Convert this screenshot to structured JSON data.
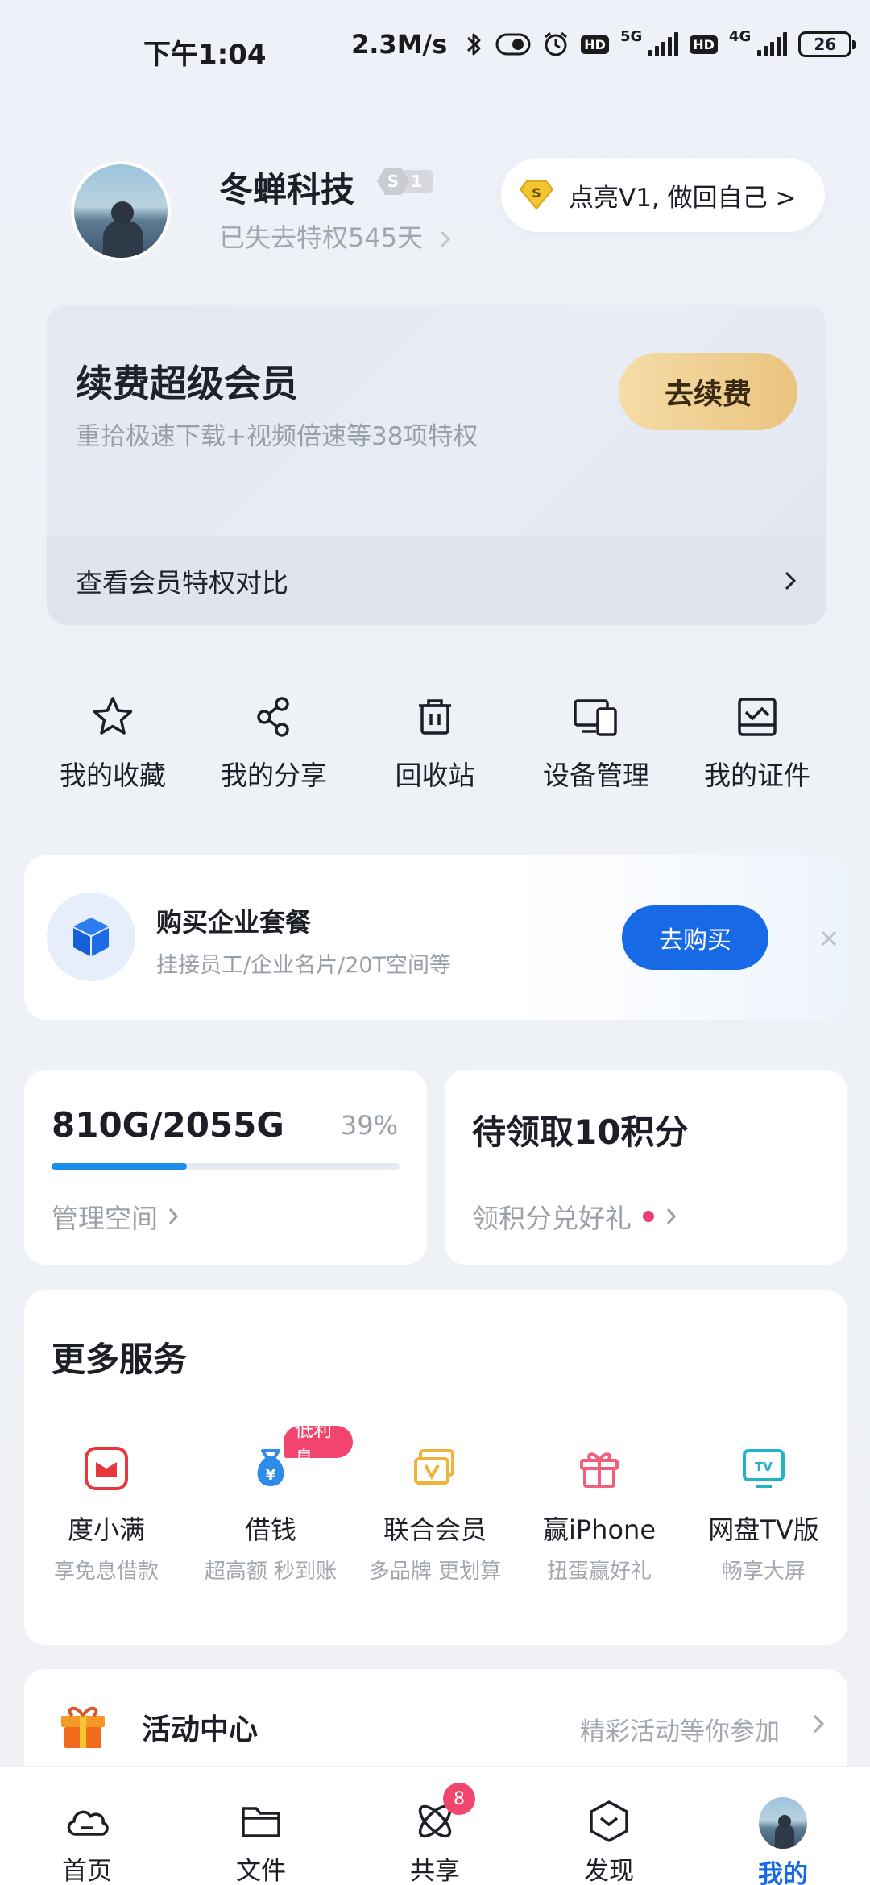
{
  "status_bar": {
    "time": "下午1:04",
    "speed": "2.3M/s",
    "hd_1": "HD",
    "net_1": "5G",
    "hd_2": "HD",
    "net_2": "4G",
    "battery": "26"
  },
  "profile": {
    "name": "冬蝉科技",
    "level_letter": "S",
    "level_number": "1",
    "expiry": "已失去特权545天",
    "v1_pill": "点亮V1, 做回自己 >",
    "coin_letter": "S"
  },
  "vip_card": {
    "title": "续费超级会员",
    "subtitle": "重拾极速下载+视频倍速等38项特权",
    "button": "去续费",
    "compare": "查看会员特权对比"
  },
  "quick_actions": [
    {
      "label": "我的收藏",
      "icon": "star-icon"
    },
    {
      "label": "我的分享",
      "icon": "share-icon"
    },
    {
      "label": "回收站",
      "icon": "trash-icon"
    },
    {
      "label": "设备管理",
      "icon": "devices-icon"
    },
    {
      "label": "我的证件",
      "icon": "id-card-icon"
    }
  ],
  "enterprise": {
    "title": "购买企业套餐",
    "subtitle": "挂接员工/企业名片/20T空间等",
    "button": "去购买"
  },
  "storage": {
    "used": "810G/2055G",
    "percent_label": "39%",
    "fraction": 0.39,
    "manage": "管理空间"
  },
  "points": {
    "title": "待领取10积分",
    "sub": "领积分兑好礼"
  },
  "services": {
    "title": "更多服务",
    "items": [
      {
        "name": "度小满",
        "desc": "享免息借款",
        "icon": "duxiaoman-icon",
        "color": "#e5393b"
      },
      {
        "name": "借钱",
        "desc": "超高额 秒到账",
        "icon": "money-bag-icon",
        "color": "#2e8bea",
        "badge": "低利息"
      },
      {
        "name": "联合会员",
        "desc": "多品牌 更划算",
        "icon": "vip-card-icon",
        "color": "#f0b33a"
      },
      {
        "name": "赢iPhone",
        "desc": "扭蛋赢好礼",
        "icon": "gift-icon",
        "color": "#f05f7c"
      },
      {
        "name": "网盘TV版",
        "desc": "畅享大屏",
        "icon": "tv-icon",
        "color": "#22b3c9"
      }
    ]
  },
  "activity": {
    "title": "活动中心",
    "hint": "精彩活动等你参加"
  },
  "bottom_nav": [
    {
      "label": "首页",
      "icon": "cloud-icon"
    },
    {
      "label": "文件",
      "icon": "folder-icon"
    },
    {
      "label": "共享",
      "icon": "share-atom-icon",
      "badge": "8"
    },
    {
      "label": "发现",
      "icon": "discover-icon"
    },
    {
      "label": "我的",
      "icon": "avatar-icon",
      "active": true
    }
  ],
  "colors": {
    "accent": "#1769e6",
    "gold": "#e9c47e",
    "badge": "#f2456d",
    "progress": "#1a8fe9"
  }
}
